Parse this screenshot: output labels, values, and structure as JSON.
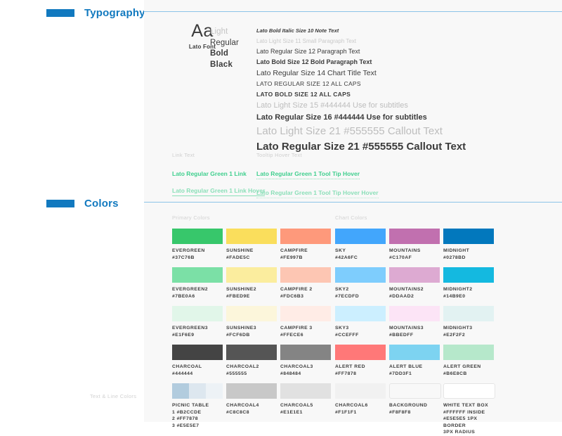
{
  "sections": [
    {
      "id": "typography",
      "title": "Typography"
    },
    {
      "id": "colors",
      "title": "Colors"
    }
  ],
  "rail_notes": {
    "text_line_colors": "Text & Line Colors"
  },
  "typography": {
    "font_sample": {
      "glyph": "Aa",
      "label": "Lato Font"
    },
    "weights": [
      "Light",
      "Regular",
      "Bold",
      "Black"
    ],
    "specimens": [
      "Lato Bold Italic Size 10 Note Text",
      "Lato Light Size 11 Small Paragraph Text",
      "Lato Regular Size 12 Paragraph Text",
      "Lato Bold Size 12 Bold Paragraph Text",
      "Lato Regular Size 14 Chart Title Text",
      "LATO REGULAR SIZE 12 ALL CAPS",
      "LATO BOLD SIZE 12 ALL CAPS",
      "Lato Light Size 15 #444444 Use for subtitles",
      "Lato Regular Size 16 #444444 Use for subtitles",
      "Lato Light Size 21 #555555 Callout Text",
      "Lato Regular Size 21 #555555 Callout Text"
    ],
    "link_group": {
      "label": "Link Text",
      "normal": "Lato Regular Green 1 Link",
      "hover": "Lato Regular Green 1 Link Hover"
    },
    "tooltip_group": {
      "label": "Tooltip Hover Text",
      "normal": "Lato Regular Green 1 Tool Tip Hover",
      "hover": "Lato Regular Green 1 Tool Tip Hover Hover"
    },
    "link_color": "#3fcf8e",
    "link_hover_color": "#8adfb8"
  },
  "colors": {
    "group_labels": {
      "primary": "Primary Colors",
      "chart": "Chart Colors"
    },
    "swatches": [
      {
        "name": "EVERGREEN",
        "hex": "#37C76B",
        "fill": "#37C76B",
        "border": false
      },
      {
        "name": "SUNSHINE",
        "hex": "#FADE5C",
        "fill": "#FADE5C",
        "border": false
      },
      {
        "name": "CAMPFIRE",
        "hex": "#FE997B",
        "fill": "#FE997B",
        "border": false
      },
      {
        "name": "SKY",
        "hex": "#42A6FC",
        "fill": "#42A6FC",
        "border": false
      },
      {
        "name": "MOUNTAINS",
        "hex": "#C170AF",
        "fill": "#C170AF",
        "border": false
      },
      {
        "name": "MIDNIGHT",
        "hex": "#0278BD",
        "fill": "#0278BD",
        "border": false
      },
      {
        "name": "EVERGREEN2",
        "hex": "#7BE0A6",
        "fill": "#7BE0A6",
        "border": false
      },
      {
        "name": "SUNSHINE2",
        "hex": "#FBED9E",
        "fill": "#FBED9E",
        "border": false
      },
      {
        "name": "CAMPFIRE 2",
        "hex": "#FDC6B3",
        "fill": "#FDC6B3",
        "border": false
      },
      {
        "name": "SKY2",
        "hex": "#7ECDFD",
        "fill": "#7ECDFD",
        "border": false
      },
      {
        "name": "MOUNTAINS2",
        "hex": "#DDAAD2",
        "fill": "#DDAAD2",
        "border": false
      },
      {
        "name": "MIDNIGHT2",
        "hex": "#14B9E0",
        "fill": "#14B9E0",
        "border": false
      },
      {
        "name": "EVERGREEN3",
        "hex": "#E1F6E9",
        "fill": "#E1F6E9",
        "border": false
      },
      {
        "name": "SUNSHINE3",
        "hex": "#FCF6DB",
        "fill": "#FCF6DB",
        "border": false
      },
      {
        "name": "CAMPFIRE 3",
        "hex": "#FFECE6",
        "fill": "#FFECE6",
        "border": false
      },
      {
        "name": "SKY3",
        "hex": "#CCEFFF",
        "fill": "#CCEFFF",
        "border": false
      },
      {
        "name": "MOUNTAINS3",
        "hex": "#BBEDFF",
        "fill": "#FCE4F6",
        "border": false
      },
      {
        "name": "MIDNIGHT3",
        "hex": "#E2F2F2",
        "fill": "#E2F2F2",
        "border": false
      },
      {
        "name": "CHARCOAL",
        "hex": "#444444",
        "fill": "#444444",
        "border": false
      },
      {
        "name": "CHARCOAL2",
        "hex": "#555555",
        "fill": "#555555",
        "border": false
      },
      {
        "name": "CHARCOAL3",
        "hex": "#848484",
        "fill": "#848484",
        "border": false
      },
      {
        "name": "ALERT RED",
        "hex": "#FF7878",
        "fill": "#FF7878",
        "border": false
      },
      {
        "name": "ALERT BLUE",
        "hex": "#7DD3F1",
        "fill": "#7DD3F1",
        "border": false
      },
      {
        "name": "ALERT GREEN",
        "hex": "#B6E8CB",
        "fill": "#B6E8CB",
        "border": false
      },
      {
        "name": "PICNIC TABLE",
        "hex": "1 #B2CCDE\n2 #FF7878\n3 #E5E5E7",
        "fill": "#B2CCDE",
        "border": false,
        "split": [
          "#B2CCDE",
          "#DDE7EF",
          "#EDF2F6"
        ]
      },
      {
        "name": "CHARCOAL4",
        "hex": "#C8C8C8",
        "fill": "#C8C8C8",
        "border": false
      },
      {
        "name": "CHARCOAL5",
        "hex": "#E1E1E1",
        "fill": "#E1E1E1",
        "border": false
      },
      {
        "name": "CHARCOAL6",
        "hex": "#F1F1F1",
        "fill": "#F1F1F1",
        "border": false
      },
      {
        "name": "BACKGROUND",
        "hex": "#F8F8F8",
        "fill": "#F8F8F8",
        "border": true
      },
      {
        "name": "WHITE TEXT BOX",
        "hex": "#FFFFFF INSIDE\n#E5E5E5 1PX BORDER\n3PX RADIUS",
        "fill": "#FFFFFF",
        "border": true
      }
    ]
  },
  "accent_color": "#1179BF",
  "rule_color": "#8CC4E8",
  "panel_bg": "#F8F8F8"
}
